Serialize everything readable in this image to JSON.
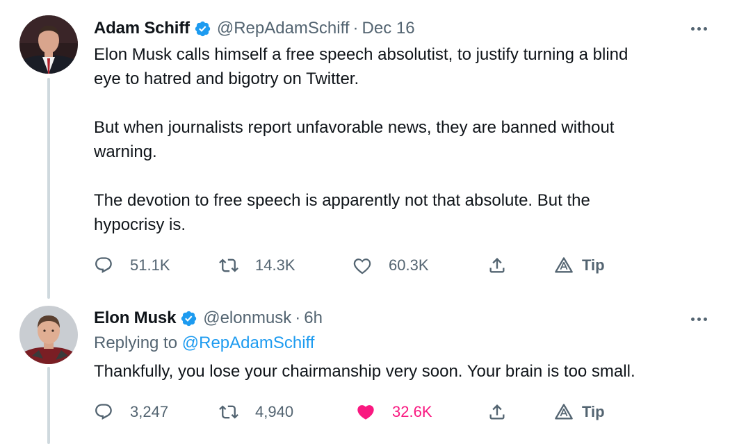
{
  "tweets": [
    {
      "name": "Adam Schiff",
      "handle": "@RepAdamSchiff",
      "separator": "·",
      "time": "Dec 16",
      "lines": [
        "Elon Musk calls himself a free speech absolutist, to justify turning a blind",
        "eye to hatred and bigotry on Twitter.",
        "But when journalists report unfavorable news, they are banned without",
        "warning.",
        "The devotion to free speech is apparently not that absolute. But the",
        "hypocrisy is."
      ],
      "replies": "51.1K",
      "retweets": "14.3K",
      "likes": "60.3K",
      "tip": "Tip",
      "liked": false
    },
    {
      "name": "Elon Musk",
      "handle": "@elonmusk",
      "separator": "·",
      "time": "6h",
      "replying_prefix": "Replying to",
      "replying_to": "@RepAdamSchiff",
      "lines": [
        "Thankfully, you lose your chairmanship very soon. Your brain is too small."
      ],
      "replies": "3,247",
      "retweets": "4,940",
      "likes": "32.6K",
      "tip": "Tip",
      "liked": true
    }
  ],
  "colors": {
    "text": "#0f1419",
    "secondary": "#536471",
    "link": "#1d9bf0",
    "like": "#f91880",
    "thread_line": "#cfd9de"
  },
  "icons": [
    "verified-icon",
    "more-icon",
    "reply-icon",
    "retweet-icon",
    "like-icon",
    "share-icon",
    "tip-icon"
  ]
}
